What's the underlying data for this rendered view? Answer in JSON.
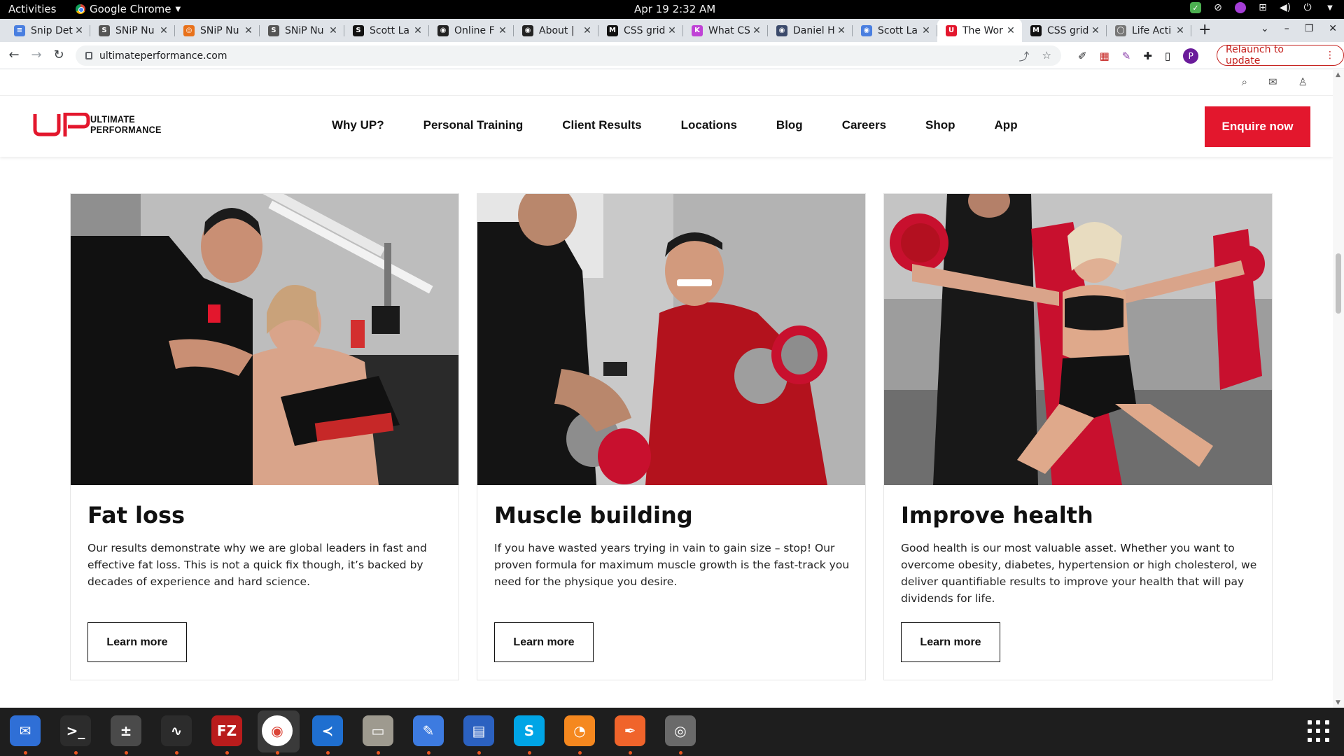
{
  "system": {
    "activities": "Activities",
    "app_name": "Google Chrome",
    "clock": "Apr 19  2:32 AM"
  },
  "tabs": [
    {
      "title": "Snip Det",
      "fav_color": "#4a7fe0",
      "fav_glyph": "≡"
    },
    {
      "title": "SNiP Nu",
      "fav_color": "#555555",
      "fav_glyph": "S"
    },
    {
      "title": "SNiP Nu",
      "fav_color": "#e8711a",
      "fav_glyph": "◎"
    },
    {
      "title": "SNiP Nu",
      "fav_color": "#555555",
      "fav_glyph": "S"
    },
    {
      "title": "Scott La",
      "fav_color": "#111111",
      "fav_glyph": "S"
    },
    {
      "title": "Online F",
      "fav_color": "#222222",
      "fav_glyph": "◉"
    },
    {
      "title": "About |",
      "fav_color": "#222222",
      "fav_glyph": "◉"
    },
    {
      "title": "CSS grid",
      "fav_color": "#111111",
      "fav_glyph": "M"
    },
    {
      "title": "What CS",
      "fav_color": "#c042d6",
      "fav_glyph": "K"
    },
    {
      "title": "Daniel H",
      "fav_color": "#3b4a6b",
      "fav_glyph": "◉"
    },
    {
      "title": "Scott La",
      "fav_color": "#4a7fe0",
      "fav_glyph": "◉"
    },
    {
      "title": "The Wor",
      "fav_color": "#e3172d",
      "fav_glyph": "U",
      "active": true
    },
    {
      "title": "CSS grid",
      "fav_color": "#111111",
      "fav_glyph": "M"
    },
    {
      "title": "Life Acti",
      "fav_color": "#777777",
      "fav_glyph": "◯"
    }
  ],
  "address_bar": {
    "url": "ultimateperformance.com",
    "relaunch_label": "Relaunch to update",
    "profile_initial": "P"
  },
  "site": {
    "logo_mark": "UP",
    "logo_line1": "ULTIMATE",
    "logo_line2": "PERFORMANCE",
    "nav": [
      "Why UP?",
      "Personal Training",
      "Client Results",
      "Locations",
      "Blog",
      "Careers",
      "Shop",
      "App"
    ],
    "cta": "Enquire now",
    "brand_color": "#e3172d"
  },
  "cards": [
    {
      "title": "Fat loss",
      "body": "Our results demonstrate why we are global leaders in fast and effective fat loss. This is not a quick fix though, it’s backed by decades of experience and hard science.",
      "button": "Learn more"
    },
    {
      "title": "Muscle building",
      "body": "If you have wasted years trying in vain to gain size – stop! Our proven formula for maximum muscle growth is the fast-track you need for the physique you desire.",
      "button": "Learn more"
    },
    {
      "title": "Improve health",
      "body": "Good health is our most valuable asset. Whether you want to overcome obesity, diabetes, hypertension or high cholesterol, we deliver quantifiable results to improve your health that will pay dividends for life.",
      "button": "Learn more"
    }
  ],
  "dock": [
    {
      "name": "thunderbird-icon",
      "color": "#2f6fd6",
      "glyph": "✉"
    },
    {
      "name": "terminal-icon",
      "color": "#2c2c2c",
      "glyph": ">_"
    },
    {
      "name": "calculator-icon",
      "color": "#4a4a4a",
      "glyph": "±"
    },
    {
      "name": "system-monitor-icon",
      "color": "#2c2c2c",
      "glyph": "∿"
    },
    {
      "name": "filezilla-icon",
      "color": "#b91c1c",
      "glyph": "FZ"
    },
    {
      "name": "chrome-icon",
      "color": "#ffffff",
      "glyph": "◉"
    },
    {
      "name": "vscode-icon",
      "color": "#1f6fd0",
      "glyph": "≺"
    },
    {
      "name": "files-icon",
      "color": "#9e9a8f",
      "glyph": "▭"
    },
    {
      "name": "text-editor-icon",
      "color": "#3d7be0",
      "glyph": "✎"
    },
    {
      "name": "document-viewer-icon",
      "color": "#2b61c0",
      "glyph": "▤"
    },
    {
      "name": "skype-icon",
      "color": "#00a5e6",
      "glyph": "S"
    },
    {
      "name": "blender-icon",
      "color": "#f5881f",
      "glyph": "◔"
    },
    {
      "name": "inkscape-icon",
      "color": "#f0642b",
      "glyph": "✒"
    },
    {
      "name": "disk-icon",
      "color": "#6a6a6a",
      "glyph": "◎"
    }
  ]
}
